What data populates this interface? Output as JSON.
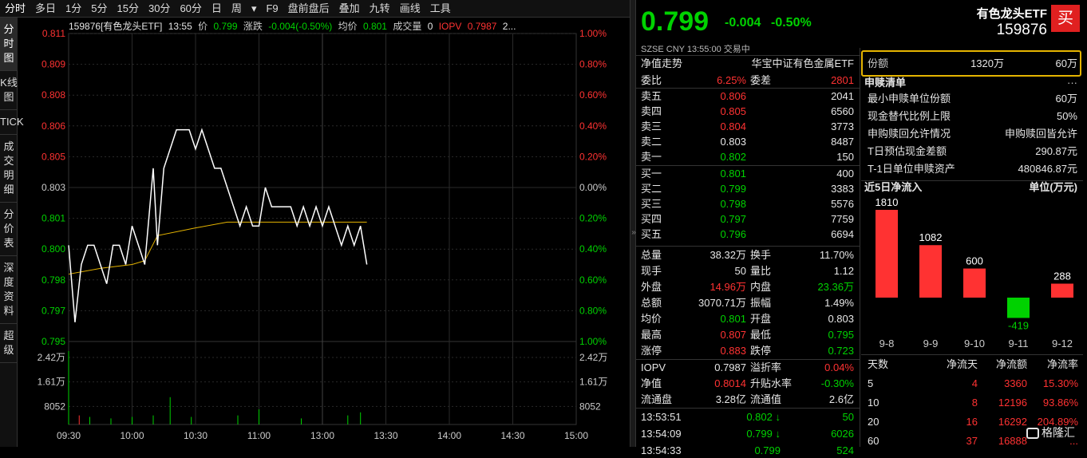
{
  "toolbar": [
    "分时",
    "多日",
    "1分",
    "5分",
    "15分",
    "30分",
    "60分",
    "日",
    "周",
    "▾",
    "F9",
    "盘前盘后",
    "叠加",
    "九转",
    "画线",
    "工具"
  ],
  "left_tabs": [
    "分时图",
    "K线图",
    "TICK",
    "成交明细",
    "分价表",
    "深度资料",
    "超级"
  ],
  "info": {
    "code_name": "159876[有色龙头ETF]",
    "time": "13:55",
    "price_label": "价",
    "price": "0.799",
    "change_label": "涨跌",
    "change": "-0.004(-0.50%)",
    "avg_label": "均价",
    "avg": "0.801",
    "vol_label": "成交量",
    "vol": "0",
    "iopv_label": "IOPV",
    "iopv": "0.7987",
    "tail": "2..."
  },
  "chart_data": {
    "type": "line",
    "title": "",
    "y_ticks": [
      "0.811",
      "0.809",
      "0.808",
      "0.806",
      "0.805",
      "0.803",
      "0.801",
      "0.800",
      "0.798",
      "0.797",
      "0.795"
    ],
    "pct_ticks": [
      "1.00%",
      "0.80%",
      "0.60%",
      "0.40%",
      "0.20%",
      "0.00%",
      "0.20%",
      "0.40%",
      "0.60%",
      "0.80%",
      "1.00%"
    ],
    "vol_ticks": [
      "2.42万",
      "1.61万",
      "8052"
    ],
    "x_ticks": [
      "09:30",
      "10:00",
      "10:30",
      "11:00",
      "13:00",
      "13:30",
      "14:00",
      "14:30",
      "15:00"
    ],
    "ylim": [
      0.795,
      0.811
    ],
    "prev_close": 0.803,
    "price": [
      [
        0,
        0.8
      ],
      [
        3,
        0.796
      ],
      [
        6,
        0.799
      ],
      [
        9,
        0.8
      ],
      [
        12,
        0.8
      ],
      [
        15,
        0.799
      ],
      [
        18,
        0.798
      ],
      [
        21,
        0.8
      ],
      [
        24,
        0.8
      ],
      [
        27,
        0.799
      ],
      [
        30,
        0.801
      ],
      [
        33,
        0.8
      ],
      [
        36,
        0.799
      ],
      [
        40,
        0.804
      ],
      [
        42,
        0.8
      ],
      [
        45,
        0.804
      ],
      [
        48,
        0.805
      ],
      [
        51,
        0.806
      ],
      [
        54,
        0.806
      ],
      [
        57,
        0.806
      ],
      [
        60,
        0.805
      ],
      [
        63,
        0.806
      ],
      [
        66,
        0.805
      ],
      [
        69,
        0.804
      ],
      [
        72,
        0.804
      ],
      [
        75,
        0.803
      ],
      [
        78,
        0.802
      ],
      [
        81,
        0.801
      ],
      [
        84,
        0.802
      ],
      [
        87,
        0.801
      ],
      [
        90,
        0.801
      ],
      [
        93,
        0.803
      ],
      [
        96,
        0.802
      ],
      [
        99,
        0.802
      ],
      [
        102,
        0.802
      ],
      [
        105,
        0.802
      ],
      [
        108,
        0.801
      ],
      [
        111,
        0.802
      ],
      [
        114,
        0.801
      ],
      [
        117,
        0.802
      ],
      [
        120,
        0.801
      ],
      [
        123,
        0.802
      ],
      [
        126,
        0.801
      ],
      [
        129,
        0.8
      ],
      [
        132,
        0.801
      ],
      [
        135,
        0.8
      ],
      [
        138,
        0.801
      ],
      [
        141,
        0.799
      ]
    ],
    "avg_line": [
      [
        0,
        0.7985
      ],
      [
        15,
        0.7988
      ],
      [
        30,
        0.799
      ],
      [
        36,
        0.7992
      ],
      [
        42,
        0.8005
      ],
      [
        60,
        0.8009
      ],
      [
        75,
        0.8012
      ],
      [
        90,
        0.8012
      ],
      [
        105,
        0.8012
      ],
      [
        120,
        0.8012
      ],
      [
        141,
        0.8012
      ]
    ],
    "volume": [
      [
        0,
        24200
      ],
      [
        5,
        3000
      ],
      [
        10,
        2500
      ],
      [
        20,
        2000
      ],
      [
        30,
        2500
      ],
      [
        40,
        3000
      ],
      [
        48,
        9000
      ],
      [
        58,
        2500
      ],
      [
        80,
        3000
      ],
      [
        90,
        5000
      ],
      [
        110,
        2000
      ],
      [
        132,
        3000
      ],
      [
        138,
        4000
      ]
    ]
  },
  "quote": {
    "price": "0.799",
    "change": "-0.004",
    "pct": "-0.50%",
    "name": "有色龙头ETF",
    "code": "159876",
    "market": "SZSE",
    "ccy": "CNY",
    "time": "13:55:00",
    "status": "交易中",
    "buy_label": "买"
  },
  "nav": {
    "label": "净值走势",
    "index": "华宝中证有色金属ETF"
  },
  "commission": [
    {
      "l": "委比",
      "v": "6.25%",
      "c": "red",
      "l2": "委差",
      "v2": "2801",
      "c2": "red"
    }
  ],
  "asks": [
    {
      "l": "卖五",
      "p": "0.806",
      "c": "red",
      "v": "2041"
    },
    {
      "l": "卖四",
      "p": "0.805",
      "c": "red",
      "v": "6560"
    },
    {
      "l": "卖三",
      "p": "0.804",
      "c": "red",
      "v": "3773"
    },
    {
      "l": "卖二",
      "p": "0.803",
      "c": "white",
      "v": "8487"
    },
    {
      "l": "卖一",
      "p": "0.802",
      "c": "green",
      "v": "150"
    }
  ],
  "bids": [
    {
      "l": "买一",
      "p": "0.801",
      "c": "green",
      "v": "400"
    },
    {
      "l": "买二",
      "p": "0.799",
      "c": "green",
      "v": "3383"
    },
    {
      "l": "买三",
      "p": "0.798",
      "c": "green",
      "v": "5576"
    },
    {
      "l": "买四",
      "p": "0.797",
      "c": "green",
      "v": "7759"
    },
    {
      "l": "买五",
      "p": "0.796",
      "c": "green",
      "v": "6694"
    }
  ],
  "stats": [
    {
      "l": "总量",
      "v": "38.32万",
      "c": "white",
      "l2": "换手",
      "v2": "11.70%",
      "c2": "white"
    },
    {
      "l": "现手",
      "v": "50",
      "c": "white",
      "l2": "量比",
      "v2": "1.12",
      "c2": "white"
    },
    {
      "l": "外盘",
      "v": "14.96万",
      "c": "red",
      "l2": "内盘",
      "v2": "23.36万",
      "c2": "green"
    },
    {
      "l": "总额",
      "v": "3070.71万",
      "c": "white",
      "l2": "振幅",
      "v2": "1.49%",
      "c2": "white"
    },
    {
      "l": "均价",
      "v": "0.801",
      "c": "green",
      "l2": "开盘",
      "v2": "0.803",
      "c2": "white"
    },
    {
      "l": "最高",
      "v": "0.807",
      "c": "red",
      "l2": "最低",
      "v2": "0.795",
      "c2": "green"
    },
    {
      "l": "涨停",
      "v": "0.883",
      "c": "red",
      "l2": "跌停",
      "v2": "0.723",
      "c2": "green"
    }
  ],
  "iopv_rows": [
    {
      "l": "IOPV",
      "v": "0.7987",
      "c": "white",
      "l2": "溢折率",
      "v2": "0.04%",
      "c2": "red"
    },
    {
      "l": "净值",
      "v": "0.8014",
      "c": "red",
      "l2": "升贴水率",
      "v2": "-0.30%",
      "c2": "green"
    },
    {
      "l": "流通盘",
      "v": "3.28亿",
      "c": "white",
      "l2": "流通值",
      "v2": "2.6亿",
      "c2": "white"
    }
  ],
  "ticks": [
    {
      "t": "13:53:51",
      "p": "0.802",
      "arrow": "↓",
      "v": "50"
    },
    {
      "t": "13:54:09",
      "p": "0.799",
      "arrow": "↓",
      "v": "6026"
    },
    {
      "t": "13:54:33",
      "p": "0.799",
      "arrow": "",
      "v": "524"
    }
  ],
  "shares": {
    "label": "份额",
    "v1": "1320万",
    "v2": "60万"
  },
  "redeem_title": "申赎清单",
  "redeem_more": "···",
  "redeem": [
    {
      "l": "最小申赎单位份额",
      "v": "60万"
    },
    {
      "l": "现金替代比例上限",
      "v": "50%"
    },
    {
      "l": "申购赎回允许情况",
      "v": "申购赎回皆允许"
    },
    {
      "l": "T日预估现金差额",
      "v": "290.87元"
    },
    {
      "l": "T-1日单位申赎资产",
      "v": "480846.87元"
    }
  ],
  "flow": {
    "title": "近5日净流入",
    "unit": "单位(万元)",
    "bars": [
      {
        "d": "9-8",
        "v": 1810
      },
      {
        "d": "9-9",
        "v": 1082
      },
      {
        "d": "9-10",
        "v": 600
      },
      {
        "d": "9-11",
        "v": -419
      },
      {
        "d": "9-12",
        "v": 288
      }
    ]
  },
  "flow_table": {
    "headers": [
      "天数",
      "净流天",
      "净流额",
      "净流率"
    ],
    "rows": [
      [
        "5",
        "4",
        "3360",
        "15.30%"
      ],
      [
        "10",
        "8",
        "12196",
        "93.86%"
      ],
      [
        "20",
        "16",
        "16292",
        "204.89%"
      ],
      [
        "60",
        "37",
        "16888",
        "..."
      ]
    ]
  },
  "watermark": "格隆汇",
  "colors": {
    "up": "#ff3232",
    "down": "#00d200",
    "price_line": "#ffffff",
    "avg_line": "#e5b400",
    "highlight": "#e5b400"
  }
}
